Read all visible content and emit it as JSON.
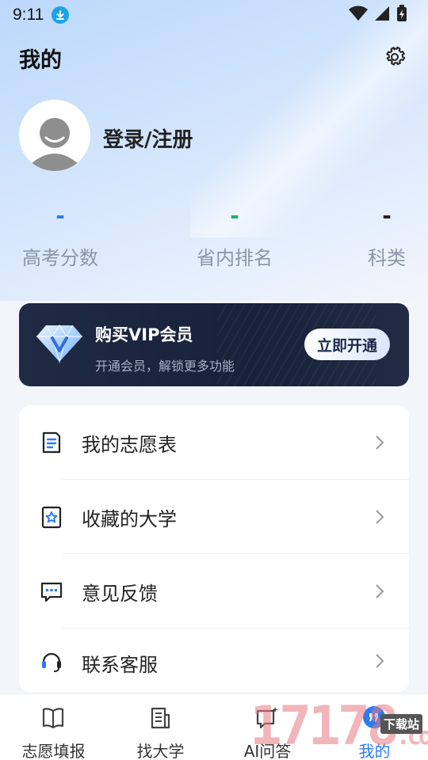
{
  "status_bar": {
    "time": "9:11"
  },
  "header": {
    "title": "我的"
  },
  "profile": {
    "login_label": "登录/注册"
  },
  "stats": [
    {
      "value": "-",
      "label": "高考分数",
      "color": "#2b7bf5"
    },
    {
      "value": "-",
      "label": "省内排名",
      "color": "#19b07a"
    },
    {
      "value": "-",
      "label": "科类",
      "color": "#222222"
    }
  ],
  "vip": {
    "title": "购买VIP会员",
    "subtitle": "开通会员，解锁更多功能",
    "button": "立即开通"
  },
  "menu": [
    {
      "label": "我的志愿表",
      "icon": "document-icon"
    },
    {
      "label": "收藏的大学",
      "icon": "star-bookmark-icon"
    },
    {
      "label": "意见反馈",
      "icon": "chat-bubble-icon"
    },
    {
      "label": "联系客服",
      "icon": "headset-icon"
    }
  ],
  "tabs": [
    {
      "label": "志愿填报",
      "icon": "book-icon"
    },
    {
      "label": "找大学",
      "icon": "building-icon"
    },
    {
      "label": "AI问答",
      "icon": "ai-chat-icon"
    },
    {
      "label": "我的",
      "icon": "profile-icon"
    }
  ],
  "watermark": {
    "number": "17178",
    "suffix": ".com",
    "tag": "下载站"
  },
  "colors": {
    "accent": "#2b7bf5",
    "vip_bg": "#1f2a44"
  }
}
